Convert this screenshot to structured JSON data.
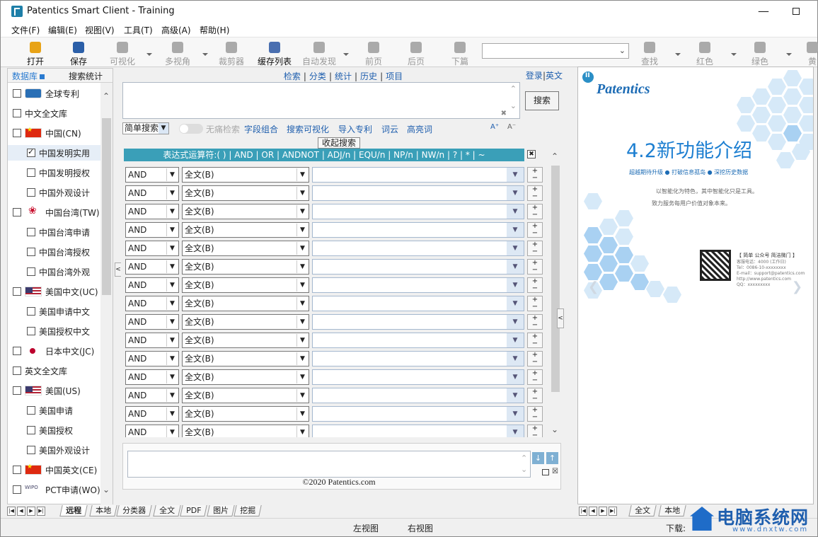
{
  "window": {
    "title": "Patentics Smart Client - Training",
    "controls": [
      "—",
      "☐",
      "✕"
    ]
  },
  "menu": [
    "文件(F)",
    "编辑(E)",
    "视图(V)",
    "工具(T)",
    "高级(A)",
    "帮助(H)"
  ],
  "toolbar": {
    "buttons": [
      {
        "label": "打开",
        "icon": "folder-open-icon",
        "enabled": true
      },
      {
        "label": "保存",
        "icon": "save-disk-icon",
        "enabled": true
      },
      {
        "label": "可视化",
        "icon": "chart-icon",
        "enabled": false
      },
      {
        "label": "多视角",
        "icon": "perspective-icon",
        "enabled": false
      },
      {
        "label": "裁剪器",
        "icon": "crop-icon",
        "enabled": false
      },
      {
        "label": "缓存列表",
        "icon": "cache-list-icon",
        "enabled": true
      },
      {
        "label": "自动发现",
        "icon": "discover-icon",
        "enabled": false
      },
      {
        "label": "前页",
        "icon": "prev-page-icon",
        "enabled": false
      },
      {
        "label": "后页",
        "icon": "next-page-icon",
        "enabled": false
      },
      {
        "label": "下篇",
        "icon": "next-doc-icon",
        "enabled": false
      },
      {
        "label": "查找",
        "icon": "find-icon",
        "enabled": false
      },
      {
        "label": "红色",
        "icon": "red-marker-icon",
        "enabled": false
      },
      {
        "label": "绿色",
        "icon": "green-marker-icon",
        "enabled": false
      },
      {
        "label": "黄",
        "icon": "yellow-marker-icon",
        "enabled": false
      }
    ],
    "combo_value": ""
  },
  "left_panel": {
    "tabs": [
      "数据库",
      "搜索统计"
    ],
    "active_tab": "数据库",
    "tree": [
      {
        "label": "全球专利",
        "checked": false,
        "level": 0,
        "flag": "globe"
      },
      {
        "label": "中文全文库",
        "checked": false,
        "level": 0,
        "flag": ""
      },
      {
        "label": "中国(CN)",
        "checked": false,
        "level": 0,
        "flag": "cn"
      },
      {
        "label": "中国发明实用",
        "checked": true,
        "level": 1,
        "flag": "",
        "selected": true
      },
      {
        "label": "中国发明授权",
        "checked": false,
        "level": 1,
        "flag": ""
      },
      {
        "label": "中国外观设计",
        "checked": false,
        "level": 1,
        "flag": ""
      },
      {
        "label": "中国台湾(TW)",
        "checked": false,
        "level": 0,
        "flag": "tw"
      },
      {
        "label": "中国台湾申请",
        "checked": false,
        "level": 1,
        "flag": ""
      },
      {
        "label": "中国台湾授权",
        "checked": false,
        "level": 1,
        "flag": ""
      },
      {
        "label": "中国台湾外观",
        "checked": false,
        "level": 1,
        "flag": ""
      },
      {
        "label": "美国中文(UC)",
        "checked": false,
        "level": 0,
        "flag": "us"
      },
      {
        "label": "美国申请中文",
        "checked": false,
        "level": 1,
        "flag": ""
      },
      {
        "label": "美国授权中文",
        "checked": false,
        "level": 1,
        "flag": ""
      },
      {
        "label": "日本中文(JC)",
        "checked": false,
        "level": 0,
        "flag": "jp"
      },
      {
        "label": "英文全文库",
        "checked": false,
        "level": 0,
        "flag": ""
      },
      {
        "label": "美国(US)",
        "checked": false,
        "level": 0,
        "flag": "us"
      },
      {
        "label": "美国申请",
        "checked": false,
        "level": 1,
        "flag": ""
      },
      {
        "label": "美国授权",
        "checked": false,
        "level": 1,
        "flag": ""
      },
      {
        "label": "美国外观设计",
        "checked": false,
        "level": 1,
        "flag": ""
      },
      {
        "label": "中国英文(CE)",
        "checked": false,
        "level": 0,
        "flag": "cn"
      },
      {
        "label": "PCT申请(WO)",
        "checked": false,
        "level": 0,
        "flag": "wo"
      }
    ]
  },
  "center": {
    "tabs": [
      "检索",
      "分类",
      "统计",
      "历史",
      "项目"
    ],
    "login": "登录",
    "lang": "英文",
    "query_value": "",
    "search_label": "搜索",
    "mode": "简单搜索",
    "options": {
      "nodup": "无痛检索",
      "field_combo": "字段组合",
      "visualize": "搜索可视化",
      "import": "导入专利",
      "wordcloud": "词云",
      "highlight": "高亮词",
      "font_up": "A⁺",
      "font_down": "A⁻"
    },
    "collapse_label": "收起搜索",
    "operator_bar": "表达式运算符:( ) | AND | OR | ANDNOT | ADJ/n | EQU/n | NP/n | NW/n | ? | * | ~",
    "rows": [
      {
        "op": "AND",
        "field": "全文(B)",
        "value": ""
      },
      {
        "op": "AND",
        "field": "全文(B)",
        "value": ""
      },
      {
        "op": "AND",
        "field": "全文(B)",
        "value": ""
      },
      {
        "op": "AND",
        "field": "全文(B)",
        "value": ""
      },
      {
        "op": "AND",
        "field": "全文(B)",
        "value": ""
      },
      {
        "op": "AND",
        "field": "全文(B)",
        "value": ""
      },
      {
        "op": "AND",
        "field": "全文(B)",
        "value": ""
      },
      {
        "op": "AND",
        "field": "全文(B)",
        "value": ""
      },
      {
        "op": "AND",
        "field": "全文(B)",
        "value": ""
      },
      {
        "op": "AND",
        "field": "全文(B)",
        "value": ""
      },
      {
        "op": "AND",
        "field": "全文(B)",
        "value": ""
      },
      {
        "op": "AND",
        "field": "全文(B)",
        "value": ""
      },
      {
        "op": "AND",
        "field": "全文(B)",
        "value": ""
      },
      {
        "op": "AND",
        "field": "全文(B)",
        "value": ""
      },
      {
        "op": "AND",
        "field": "全文(B)",
        "value": ""
      }
    ],
    "bottom_text": "",
    "copyright": "©2020 Patentics.com"
  },
  "right_panel": {
    "logo": "Patentics",
    "slide_title": "4.2新功能介绍",
    "slide_line1": "超越期待升级 ● 打破信息孤岛 ● 深挖历史数据",
    "slide_line2": "以智能化为特色，其中智能化只是工具。",
    "slide_line3": "致力服务每用户价值对象本来。",
    "contact_header": "【 简单 公众号   简洁微门 】",
    "contact_lines": [
      "客服电话：4000 (工作日)",
      "Tel：0086-10-xxxxxxxx",
      "E-mail：support@patentics.com",
      "http://www.patentics.com",
      "QQ：xxxxxxxxx"
    ]
  },
  "sheet_tabs": [
    "远程",
    "本地",
    "分类器",
    "全文",
    "PDF",
    "图片",
    "挖掘"
  ],
  "active_sheet": "远程",
  "sheet_tabs_right": [
    "全文",
    "本地"
  ],
  "status": {
    "left_view": "左视图",
    "right_view": "右视图",
    "download": "下载:"
  },
  "watermark": {
    "title": "电脑系统网",
    "url": "www.dnxtw.com"
  },
  "colors": {
    "accent": "#1f5fae",
    "operator_bar": "#3a9fb8",
    "slide_title": "#1d7fd1"
  }
}
